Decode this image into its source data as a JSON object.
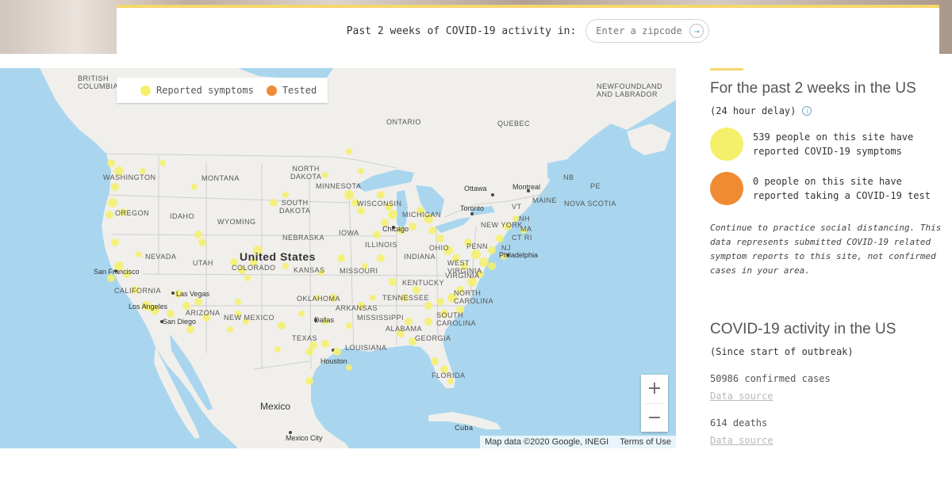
{
  "header": {
    "prompt": "Past 2 weeks of COVID-19 activity in:",
    "zip_placeholder": "Enter a zipcode",
    "go_icon": "arrow-right-icon"
  },
  "legend": {
    "items": [
      {
        "label": "Reported symptoms",
        "color": "#f5f06a"
      },
      {
        "label": "Tested",
        "color": "#f08a33"
      }
    ]
  },
  "map": {
    "labels": {
      "british_columbia": "BRITISH\nCOLUMBIA",
      "newfoundland": "NEWFOUNDLAND\nAND LABRADOR",
      "ontario": "ONTARIO",
      "quebec": "QUEBEC",
      "nb": "NB",
      "pe": "PE",
      "nova_scotia": "NOVA SCOTIA",
      "washington": "WASHINGTON",
      "montana": "MONTANA",
      "north_dakota": "NORTH\nDAKOTA",
      "minnesota": "MINNESOTA",
      "south_dakota": "SOUTH\nDAKOTA",
      "oregon": "OREGON",
      "idaho": "IDAHO",
      "wyoming": "WYOMING",
      "wisconsin": "WISCONSIN",
      "michigan": "MICHIGAN",
      "nebraska": "NEBRASKA",
      "iowa": "IOWA",
      "nevada": "NEVADA",
      "utah": "UTAH",
      "colorado": "COLORADO",
      "kansas": "KANSAS",
      "missouri": "MISSOURI",
      "illinois": "ILLINOIS",
      "indiana": "INDIANA",
      "ohio": "OHIO",
      "penn": "PENN",
      "new_york": "NEW YORK",
      "maine": "MAINE",
      "vt": "VT",
      "nh": "NH",
      "ma": "MA",
      "ct": "CT RI",
      "nj": "NJ",
      "california": "CALIFORNIA",
      "arizona": "ARIZONA",
      "new_mexico": "NEW MEXICO",
      "oklahoma": "OKLAHOMA",
      "arkansas": "ARKANSAS",
      "tennessee": "TENNESSEE",
      "kentucky": "KENTUCKY",
      "virginia": "VIRGINIA",
      "west_virginia": "WEST\nVIRGINIA",
      "north_carolina": "NORTH\nCAROLINA",
      "south_carolina": "SOUTH\nCAROLINA",
      "texas": "TEXAS",
      "mississippi": "MISSISSIPPI",
      "alabama": "ALABAMA",
      "georgia": "GEORGIA",
      "louisiana": "LOUISIANA",
      "florida": "FLORIDA",
      "united_states": "United States",
      "mexico": "Mexico",
      "cuba": "Cuba"
    },
    "cities": {
      "ottawa": "Ottawa",
      "montreal": "Montreal",
      "toronto": "Toronto",
      "chicago": "Chicago",
      "philadelphia": "Philadelphia",
      "san_francisco": "San Francisco",
      "las_vegas": "Las Vegas",
      "los_angeles": "Los Angeles",
      "san_diego": "San Diego",
      "dallas": "Dallas",
      "houston": "Houston",
      "mexico_city": "Mexico City"
    },
    "zoom_in": "+",
    "zoom_out": "−",
    "attribution": "Map data ©2020 Google, INEGI",
    "terms": "Terms of Use",
    "water_color": "#a9d6ee",
    "land_color": "#f0efec"
  },
  "sidebar": {
    "two_week_title": "For the past 2 weeks in the US",
    "delay_note": "(24 hour delay)",
    "info_icon": "info-icon",
    "symptoms_stat": "539 people on this site have reported COVID-19 symptoms",
    "tested_stat": "0 people on this site have reported taking a COVID-19 test",
    "symptom_color": "#f5f06a",
    "tested_color": "#f08a33",
    "disclaimer": "Continue to practice social distancing. This data represents submitted COVID-19 related symptom reports to this site, not confirmed cases in your area.",
    "us_title": "COVID-19 activity in the US",
    "us_since": "(Since start of outbreak)",
    "confirmed_cases": "50986 confirmed cases",
    "deaths": "614 deaths",
    "data_source_label": "Data source"
  }
}
